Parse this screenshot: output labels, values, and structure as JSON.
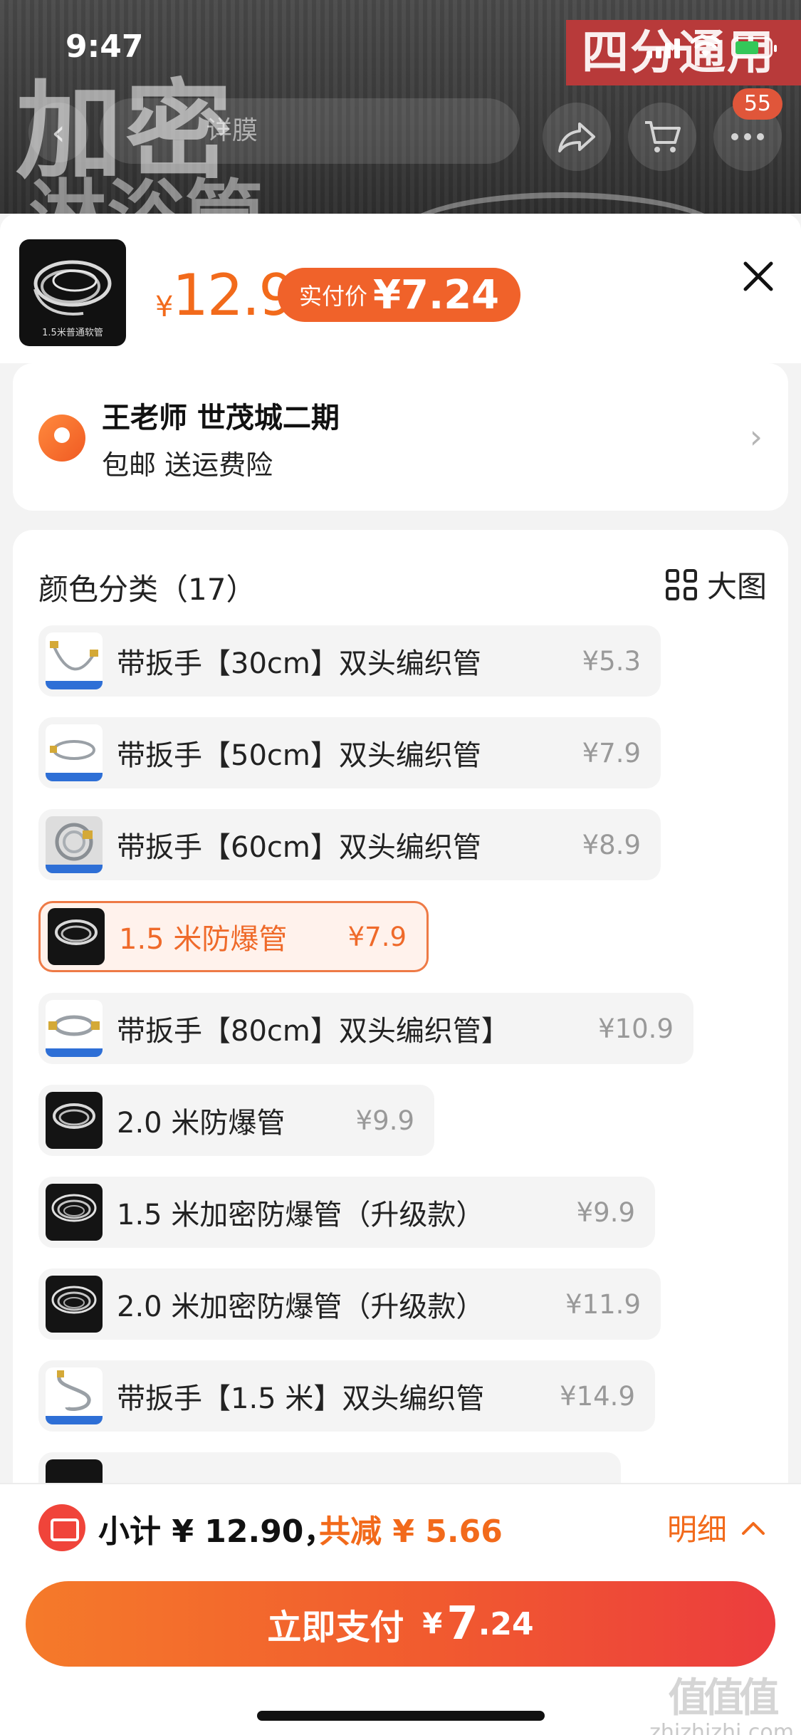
{
  "status_bar": {
    "time": "9:47"
  },
  "background": {
    "title_line1": "加密",
    "title_line2": "淋浴管",
    "banner": "四分通用",
    "search_text": "详膜",
    "cart_badge": "55"
  },
  "product": {
    "currency": "¥",
    "price": "12.9",
    "paid_label": "实付价",
    "paid_value": "¥7.24",
    "thumb_caption": "1.5米普通软管"
  },
  "address": {
    "name_line": "王老师 世茂城二期",
    "shipping_line": "包邮  送运费险"
  },
  "spec": {
    "title": "颜色分类（17）",
    "big_image_label": "大图",
    "options": [
      {
        "name": "带扳手【30cm】双头编织管",
        "price": "¥5.3",
        "selected": false
      },
      {
        "name": "带扳手【50cm】双头编织管",
        "price": "¥7.9",
        "selected": false
      },
      {
        "name": "带扳手【60cm】双头编织管",
        "price": "¥8.9",
        "selected": false
      },
      {
        "name": "1.5 米防爆管",
        "price": "¥7.9",
        "selected": true
      },
      {
        "name": "带扳手【80cm】双头编织管】",
        "price": "¥10.9",
        "selected": false
      },
      {
        "name": "2.0 米防爆管",
        "price": "¥9.9",
        "selected": false
      },
      {
        "name": "1.5 米加密防爆管（升级款）",
        "price": "¥9.9",
        "selected": false
      },
      {
        "name": "2.0 米加密防爆管（升级款）",
        "price": "¥11.9",
        "selected": false
      },
      {
        "name": "带扳手【1.5 米】双头编织管",
        "price": "¥14.9",
        "selected": false
      }
    ]
  },
  "footer": {
    "subtotal": "小计 ¥ 12.90，",
    "saved": "共减 ¥ 5.66",
    "detail_label": "明细",
    "pay_label": "立即支付",
    "pay_currency": "¥",
    "pay_int": "7",
    "pay_dec": ".24"
  },
  "watermark": {
    "glyphs": "值值值",
    "site": "zhizhizhi.com"
  },
  "colors": {
    "accent": "#f26a1b",
    "pay_gradient_end": "#ec3d3e",
    "selected_bg": "#fff2ec"
  }
}
